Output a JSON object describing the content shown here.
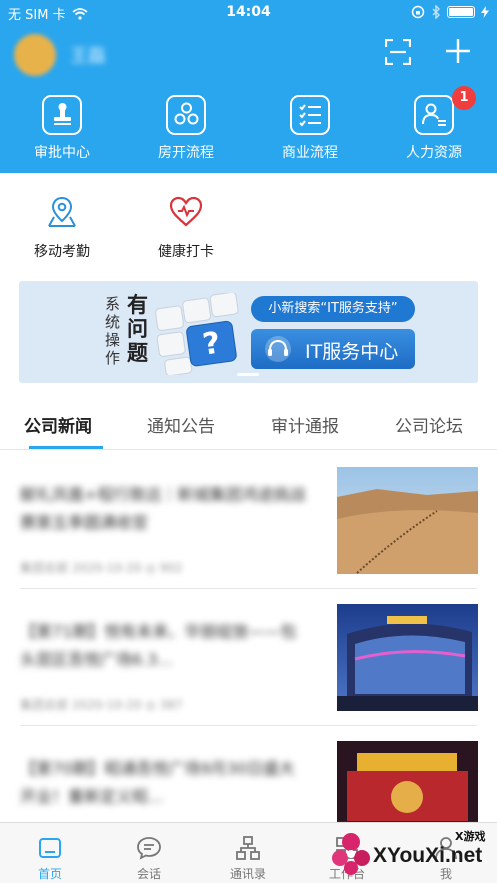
{
  "status_bar": {
    "carrier": "无 SIM 卡",
    "time": "14:04"
  },
  "header": {
    "username": "王磊"
  },
  "quick_actions": [
    {
      "label": "审批中心",
      "icon": "stamp-icon"
    },
    {
      "label": "房开流程",
      "icon": "flow-icon"
    },
    {
      "label": "商业流程",
      "icon": "checklist-icon"
    },
    {
      "label": "人力资源",
      "icon": "person-card-icon",
      "badge": "1"
    }
  ],
  "apps": [
    {
      "label": "移动考勤",
      "icon": "location-pin-icon"
    },
    {
      "label": "健康打卡",
      "icon": "heart-icon"
    }
  ],
  "banner": {
    "side_text_small": "系统操作",
    "side_text_big": "有问题",
    "pill_text": "小新搜索“IT服务支持”",
    "it_center_label": "IT服务中心"
  },
  "tabs": [
    {
      "label": "公司新闻",
      "active": true
    },
    {
      "label": "通知公告",
      "active": false
    },
    {
      "label": "审计通报",
      "active": false
    },
    {
      "label": "公司论坛",
      "active": false
    }
  ],
  "news": [
    {
      "title": "献礼凤凰+程行致远｜新城集团鸿途挑战赛第五季圆满收官",
      "meta": "集团总部  2020-10-20  ◎ 902"
    },
    {
      "title": "【第71期】悦有未来、华丽绽放——包头昆区吾悦广场6.3...",
      "meta": "集团总部  2020-10-20  ◎ 387"
    },
    {
      "title": "【第70期】昭通吾悦广场9月30日盛大开业！重新定义昭...",
      "meta": ""
    }
  ],
  "tab_bar": [
    {
      "label": "首页",
      "icon": "home-icon",
      "active": true
    },
    {
      "label": "会话",
      "icon": "chat-icon",
      "active": false
    },
    {
      "label": "通讯录",
      "icon": "org-chart-icon",
      "active": false
    },
    {
      "label": "工作台",
      "icon": "grid-icon",
      "active": false
    },
    {
      "label": "我",
      "icon": "person-icon",
      "active": false
    }
  ],
  "watermark": {
    "small": "X游戏",
    "big": "XYouXi.net"
  },
  "colors": {
    "primary": "#2aa6ee",
    "badge": "#f03e3e"
  }
}
